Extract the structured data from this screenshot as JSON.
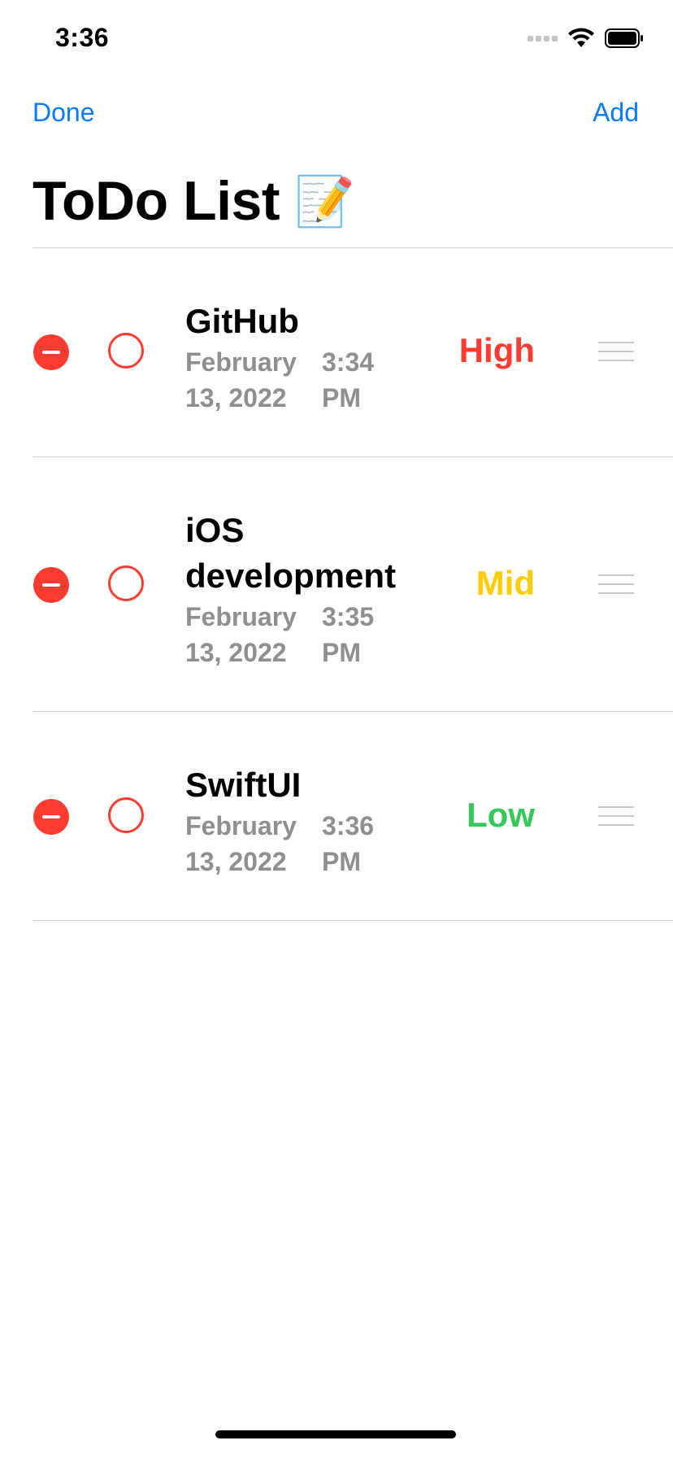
{
  "status": {
    "time": "3:36"
  },
  "nav": {
    "done_label": "Done",
    "add_label": "Add"
  },
  "title": {
    "text": "ToDo List",
    "emoji": "📝"
  },
  "colors": {
    "accent": "#0a7aff",
    "delete": "#fe3b30",
    "high": "#fe3b30",
    "mid": "#ffcc00",
    "low": "#34c759",
    "secondary_text": "#8e8e93"
  },
  "tasks": [
    {
      "title_lines": [
        "GitHub"
      ],
      "date_lines": [
        "February",
        "13, 2022"
      ],
      "time_lines": [
        "3:34",
        "PM"
      ],
      "priority": "High",
      "priority_color": "#fe3b30"
    },
    {
      "title_lines": [
        "iOS",
        "development"
      ],
      "date_lines": [
        "February",
        "13, 2022"
      ],
      "time_lines": [
        "3:35",
        "PM"
      ],
      "priority": "Mid",
      "priority_color": "#ffcc00"
    },
    {
      "title_lines": [
        "SwiftUI"
      ],
      "date_lines": [
        "February",
        "13, 2022"
      ],
      "time_lines": [
        "3:36",
        "PM"
      ],
      "priority": "Low",
      "priority_color": "#34c759"
    }
  ]
}
